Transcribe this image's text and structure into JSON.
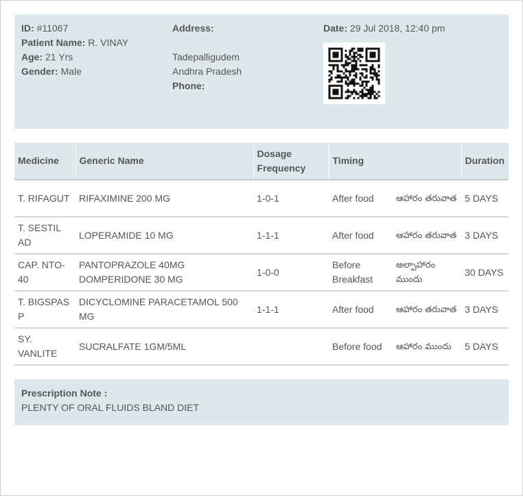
{
  "patient": {
    "id_label": "ID:",
    "id_value": "#11067",
    "name_label": "Patient Name:",
    "name_value": "R. VINAY",
    "age_label": "Age:",
    "age_value": "21 Yrs",
    "gender_label": "Gender:",
    "gender_value": "Male"
  },
  "address": {
    "label": "Address:",
    "line1": "Tadepalligudem",
    "line2": "Andhra Pradesh",
    "phone_label": "Phone:"
  },
  "visit": {
    "date_label": "Date:",
    "date_value": "29 Jul 2018, 12:40 pm",
    "qr_icon": "qr-code-icon"
  },
  "table": {
    "headers": {
      "medicine": "Medicine",
      "generic": "Generic Name",
      "dosage": "Dosage Frequency",
      "timing": "Timing",
      "duration": "Duration"
    },
    "rows": [
      {
        "medicine": "T. RIFAGUT",
        "generic": "RIFAXIMINE 200 MG",
        "dosage": "1-0-1",
        "timing": "After food",
        "timing_local": "ఆహారం తరువాత",
        "duration": "5 DAYS"
      },
      {
        "medicine": "T. SESTIL AD",
        "generic": "LOPERAMIDE 10 MG",
        "dosage": "1-1-1",
        "timing": "After food",
        "timing_local": "ఆహారం తరువాత",
        "duration": "3 DAYS"
      },
      {
        "medicine": "CAP. NTO-40",
        "generic": "PANTOPRAZOLE 40MG DOMPERIDONE 30 MG",
        "dosage": "1-0-0",
        "timing": "Before Breakfast",
        "timing_local": "అల్పాహారం ముందు",
        "duration": "30 DAYS"
      },
      {
        "medicine": "T. BIGSPAS P",
        "generic": "DICYCLOMINE PARACETAMOL 500 MG",
        "dosage": "1-1-1",
        "timing": "After food",
        "timing_local": "ఆహారం తరువాత",
        "duration": "3 DAYS"
      },
      {
        "medicine": "SY. VANLITE",
        "generic": "SUCRALFATE 1GM/5ML",
        "dosage": "",
        "timing": "Before food",
        "timing_local": "ఆహారం ముందు",
        "duration": "5 DAYS"
      }
    ]
  },
  "note": {
    "label": "Prescription Note :",
    "text": "PLENTY OF ORAL FLUIDS BLAND DIET"
  }
}
